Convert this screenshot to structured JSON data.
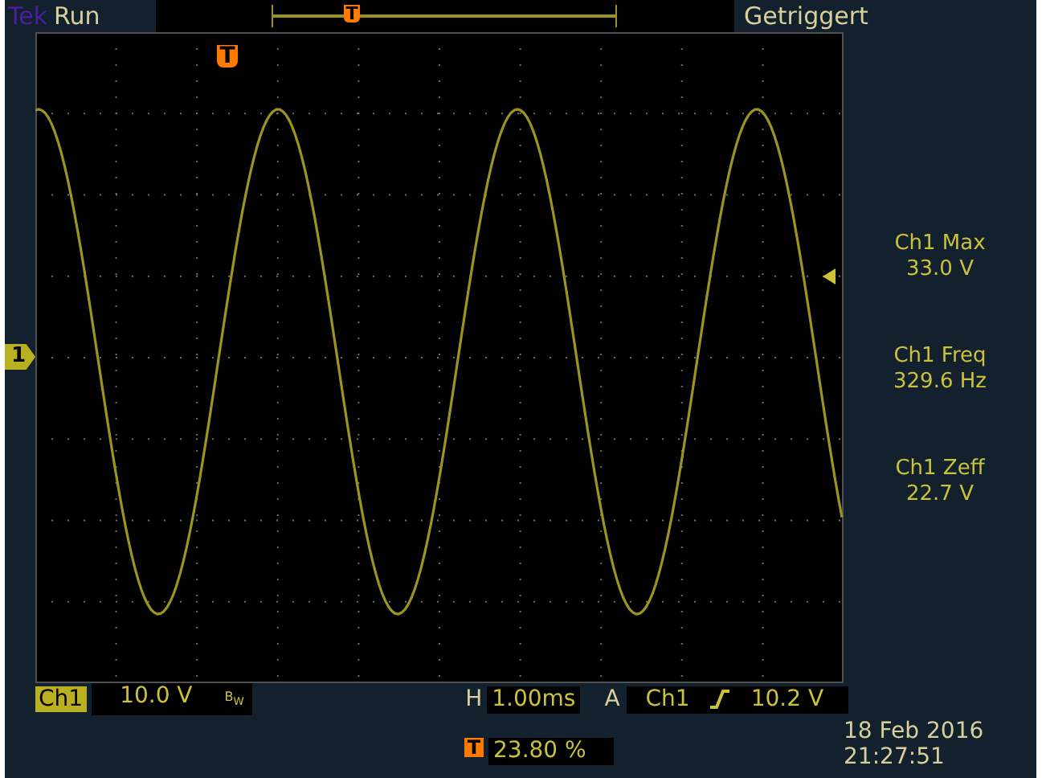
{
  "header": {
    "brand": "Tek",
    "status": "Run",
    "record_marker": "T",
    "trigger_state": "Getriggert"
  },
  "screen": {
    "trigger_marker": "T",
    "channel_marker": "1"
  },
  "measurements": [
    {
      "name": "Ch1 Max",
      "value": "33.0 V"
    },
    {
      "name": "Ch1 Freq",
      "value": "329.6 Hz"
    },
    {
      "name": "Ch1 Zeff",
      "value": "22.7 V"
    }
  ],
  "vertical": {
    "channel": "Ch1",
    "scale": "10.0 V",
    "bandwidth": "B$_{W}$"
  },
  "horizontal": {
    "label": "H",
    "timebase": "1.00ms"
  },
  "trigger": {
    "label": "A",
    "source": "Ch1",
    "kind": "rising",
    "level": "10.2 V"
  },
  "position": {
    "marker": "T",
    "value": "23.80 %"
  },
  "clock": {
    "date": "18 Feb  2016",
    "time": "21:27:51"
  }
}
